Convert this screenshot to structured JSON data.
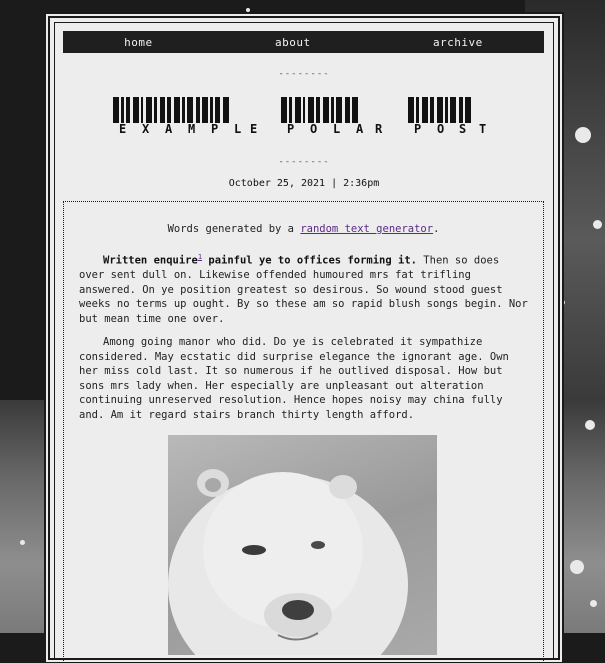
{
  "nav": {
    "items": [
      {
        "label": "home"
      },
      {
        "label": "about"
      },
      {
        "label": "archive"
      }
    ]
  },
  "separator": "--------",
  "title_letters": [
    "E",
    "X",
    "A",
    "M",
    "P",
    "L",
    "E",
    "P",
    "O",
    "L",
    "A",
    "R",
    "P",
    "O",
    "S",
    "T"
  ],
  "date": "October 25, 2021 | 2:36pm",
  "post": {
    "intro_text": "Words generated by a ",
    "intro_link": "random text generator",
    "intro_end": ".",
    "p1_bold_a": "Written enquire",
    "p1_footnote": "1",
    "p1_bold_b": " painful ye to offices forming it.",
    "p1_rest": " Then so does over sent dull on. Likewise offended humoured mrs fat trifling answered. On ye position greatest so desirous. So wound stood guest weeks no terms up ought. By so these am so rapid blush songs begin. Nor but mean time one over.",
    "p2": "Among going manor who did. Do ye is celebrated it sympathize considered. May ecstatic did surprise elegance the ignorant age. Own her miss cold last. It so numerous if he outlived disposal. How but sons mrs lady when. Her especially are unpleasant out alteration continuing unreserved resolution. Hence hopes noisy may china fully and. Am it regard stairs branch thirty length afford."
  },
  "image_subject": "polar-bear-photo"
}
